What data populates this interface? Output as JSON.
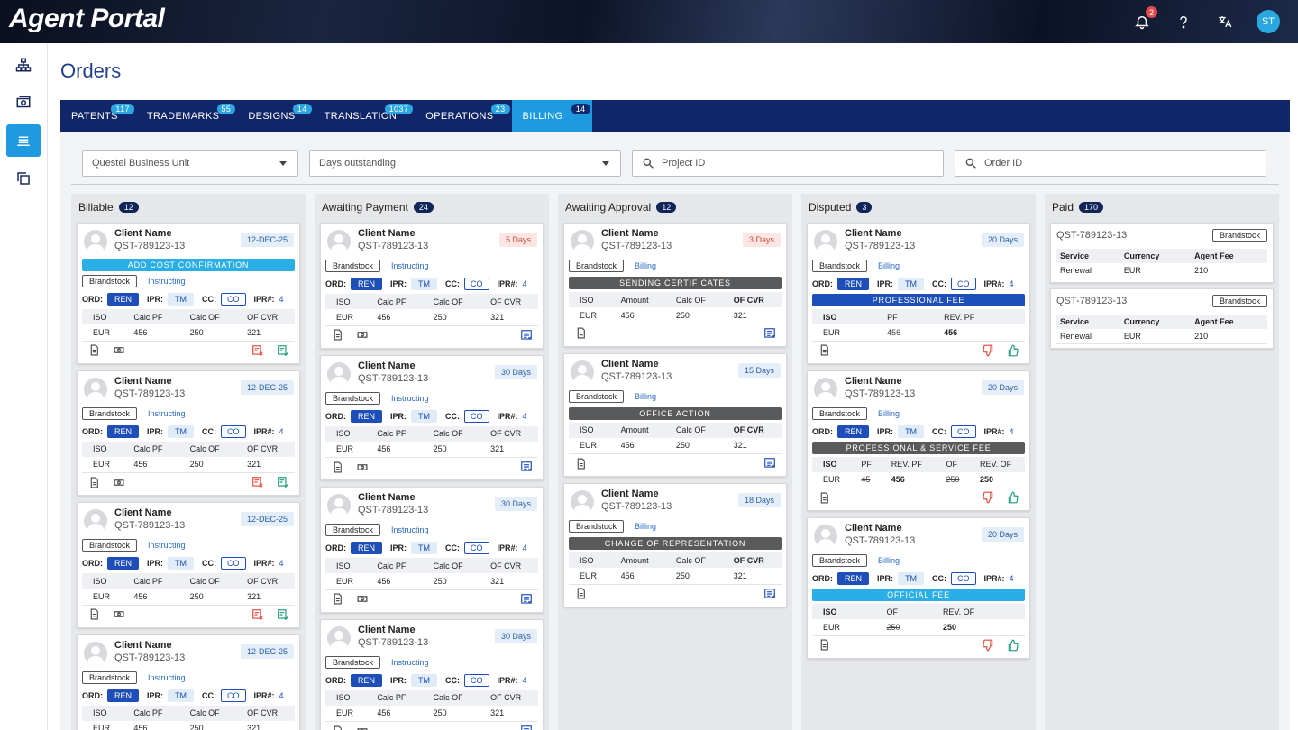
{
  "header": {
    "app_title": "Agent Portal",
    "notif_count": "2",
    "avatar_initials": "ST"
  },
  "page": {
    "title": "Orders"
  },
  "tabs": [
    {
      "label": "PATENTS",
      "count": "117"
    },
    {
      "label": "TRADEMARKS",
      "count": "55"
    },
    {
      "label": "DESIGNS",
      "count": "14"
    },
    {
      "label": "TRANSLATION",
      "count": "1037"
    },
    {
      "label": "OPERATIONS",
      "count": "23"
    },
    {
      "label": "BILLING",
      "count": "14"
    }
  ],
  "filters": {
    "business_unit": "Questel Business Unit",
    "days_outstanding": "Days outstanding",
    "project_id_placeholder": "Project ID",
    "order_id_placeholder": "Order ID"
  },
  "columns": {
    "billable": {
      "title": "Billable",
      "count": "12"
    },
    "awaiting_payment": {
      "title": "Awaiting Payment",
      "count": "24"
    },
    "awaiting_approval": {
      "title": "Awaiting Approval",
      "count": "12"
    },
    "disputed": {
      "title": "Disputed",
      "count": "3"
    },
    "paid": {
      "title": "Paid",
      "count": "170"
    }
  },
  "card": {
    "client_name": "Client Name",
    "qst": "QST-789123-13",
    "brand": "Brandstock",
    "instructing": "Instructing",
    "billing": "Billing",
    "ord_label": "ORD:",
    "ren": "REN",
    "ipr_label": "IPR:",
    "tm": "TM",
    "cc_label": "CC:",
    "co": "CO",
    "iprn_label": "IPR#:",
    "ipr_num": "4",
    "eur": "EUR",
    "iso": "ISO"
  },
  "billable": {
    "date": "12-DEC-25",
    "banner": "ADD COST CONFIRMATION",
    "headers": [
      "ISO",
      "Calc PF",
      "Calc OF",
      "OF CVR"
    ],
    "row": [
      "EUR",
      "456",
      "250",
      "321"
    ]
  },
  "awaiting_payment": {
    "days": [
      "5 Days",
      "30 Days",
      "30 Days",
      "30 Days"
    ],
    "headers": [
      "ISO",
      "Calc PF",
      "Calc OF",
      "OF CVR"
    ],
    "row": [
      "EUR",
      "456",
      "250",
      "321"
    ]
  },
  "awaiting_approval": {
    "cards": [
      {
        "days": "3 Days",
        "banner": "SENDING CERTIFICATES"
      },
      {
        "days": "15 Days",
        "banner": "OFFICE ACTION"
      },
      {
        "days": "18 Days",
        "banner": "CHANGE OF REPRESENTATION"
      }
    ],
    "headers": [
      "ISO",
      "Amount",
      "Calc OF",
      "OF CVR"
    ],
    "row": [
      "EUR",
      "456",
      "250",
      "321"
    ]
  },
  "disputed": {
    "cards": [
      {
        "days": "20 Days",
        "banner": "PROFESSIONAL FEE",
        "headers": [
          "ISO",
          "PF",
          "REV. PF"
        ],
        "row": [
          "EUR",
          "456",
          "456"
        ]
      },
      {
        "days": "20 Days",
        "banner": "PROFESSIONAL & SERVICE FEE",
        "headers": [
          "ISO",
          "PF",
          "REV. PF",
          "OF",
          "REV. OF"
        ],
        "row": [
          "EUR",
          "45",
          "456",
          "250",
          "250"
        ]
      },
      {
        "days": "20 Days",
        "banner": "OFFICIAL FEE",
        "headers": [
          "ISO",
          "OF",
          "REV. OF"
        ],
        "row": [
          "EUR",
          "250",
          "250"
        ]
      }
    ]
  },
  "paid": {
    "headers": [
      "Service",
      "Currency",
      "Agent Fee"
    ],
    "row": [
      "Renewal",
      "EUR",
      "210"
    ]
  }
}
